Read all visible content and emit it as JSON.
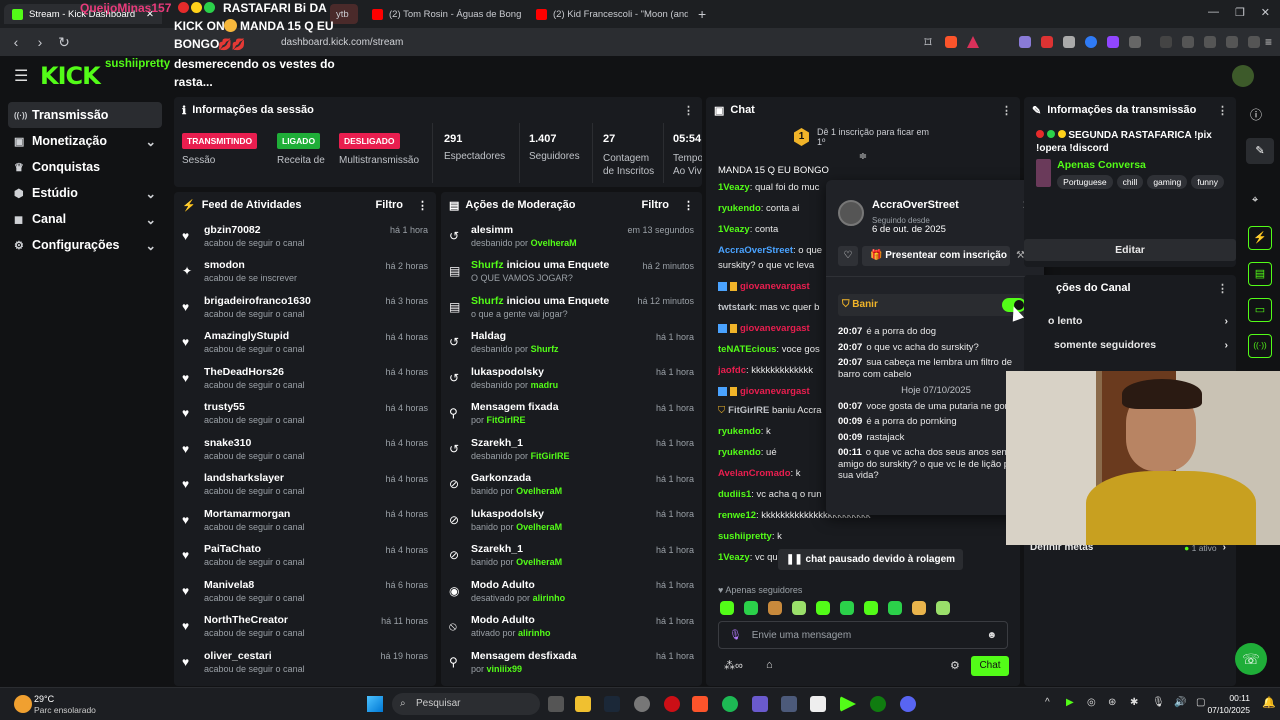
{
  "browser": {
    "tabs": [
      {
        "label": "Stream - Kick Dashboard",
        "active": true
      },
      {
        "label": "ytb"
      },
      {
        "label": "(2) Tom Rosin - Águas de Bong - You"
      },
      {
        "label": "(2) Kid Francescoli - \"Moon (and it w"
      }
    ],
    "new_tab": "+",
    "address": "dashboard.kick.com/stream"
  },
  "overlay": {
    "user": "QueijoMinas157",
    "line1": "RASTAFARI Bi DA",
    "line2": "KICK ON",
    "line2b": "MANDA 15 Q EU",
    "line3": "BONGO",
    "line4": "desmerecendo os vestes do",
    "line5": "rasta..."
  },
  "header": {
    "logo": "KICK",
    "username": "sushiipretty"
  },
  "sidebar": {
    "items": [
      {
        "label": "Transmissão",
        "icon": "broadcast-icon",
        "glyph": "((·))",
        "active": true
      },
      {
        "label": "Monetização",
        "icon": "monetization-icon",
        "glyph": "▣",
        "chevron": true
      },
      {
        "label": "Conquistas",
        "icon": "trophy-icon",
        "glyph": "🏆"
      },
      {
        "label": "Estúdio",
        "icon": "studio-icon",
        "glyph": "⬢",
        "chevron": true
      },
      {
        "label": "Canal",
        "icon": "channel-icon",
        "glyph": "◼",
        "chevron": true
      },
      {
        "label": "Configurações",
        "icon": "settings-icon",
        "glyph": "⚙",
        "chevron": true
      }
    ]
  },
  "session": {
    "title": "Informações da sessão",
    "badges": [
      {
        "text": "TRANSMITINDO",
        "color": "#e91e4f",
        "label": "Sessão"
      },
      {
        "text": "LIGADO",
        "color": "#1fae38",
        "label": "Receita de"
      },
      {
        "text": "DESLIGADO",
        "color": "#e91e4f",
        "label": "Multistransmissão"
      }
    ],
    "stats": [
      {
        "value": "291",
        "label": "Espectadores"
      },
      {
        "value": "1.407",
        "label": "Seguidores"
      },
      {
        "value": "27",
        "label": "Contagem de Inscritos"
      },
      {
        "value": "05:54:",
        "label": "Tempo Ao Vivo"
      }
    ]
  },
  "activity": {
    "title": "Feed de Atividades",
    "filter": "Filtro",
    "rows": [
      {
        "name": "gbzin70082",
        "sub": "acabou de seguir o canal",
        "time": "há 1 hora"
      },
      {
        "name": "smodon",
        "sub": "acabou de se inscrever",
        "time": "há 2 horas",
        "sub_icon": true
      },
      {
        "name": "brigadeirofranco1630",
        "sub": "acabou de seguir o canal",
        "time": "há 3 horas"
      },
      {
        "name": "AmazinglyStupid",
        "sub": "acabou de seguir o canal",
        "time": "há 4 horas"
      },
      {
        "name": "TheDeadHors26",
        "sub": "acabou de seguir o canal",
        "time": "há 4 horas"
      },
      {
        "name": "trusty55",
        "sub": "acabou de seguir o canal",
        "time": "há 4 horas"
      },
      {
        "name": "snake310",
        "sub": "acabou de seguir o canal",
        "time": "há 4 horas"
      },
      {
        "name": "landsharkslayer",
        "sub": "acabou de seguir o canal",
        "time": "há 4 horas"
      },
      {
        "name": "Mortamarmorgan",
        "sub": "acabou de seguir o canal",
        "time": "há 4 horas"
      },
      {
        "name": "PaiTaChato",
        "sub": "acabou de seguir o canal",
        "time": "há 4 horas"
      },
      {
        "name": "Manivela8",
        "sub": "acabou de seguir o canal",
        "time": "há 6 horas"
      },
      {
        "name": "NorthTheCreator",
        "sub": "acabou de seguir o canal",
        "time": "há 11 horas"
      },
      {
        "name": "oliver_cestari",
        "sub": "acabou de seguir o canal",
        "time": "há 19 horas"
      }
    ]
  },
  "moderation": {
    "title": "Ações de Moderação",
    "filter": "Filtro",
    "rows": [
      {
        "icon": "undo-icon",
        "glyph": "↺",
        "name": "alesimm",
        "sub": "desbanido por",
        "by": "OvelheraM",
        "time": "em 13 segundos"
      },
      {
        "icon": "poll-icon",
        "glyph": "▤",
        "name": "Shurfz",
        "name_green": true,
        "rest": " iniciou uma Enquete",
        "sub": "O QUE VAMOS JOGAR?",
        "time": "há 2 minutos"
      },
      {
        "icon": "poll-icon",
        "glyph": "▤",
        "name": "Shurfz",
        "name_green": true,
        "rest": " iniciou uma Enquete",
        "sub": "o que a gente vai jogar?",
        "time": "há 12 minutos"
      },
      {
        "icon": "undo-icon",
        "glyph": "↺",
        "name": "Haldag",
        "sub": "desbanido por",
        "by": "Shurfz",
        "time": "há 1 hora"
      },
      {
        "icon": "undo-icon",
        "glyph": "↺",
        "name": "lukaspodolsky",
        "sub": "desbanido por",
        "by": "madru",
        "time": "há 1 hora"
      },
      {
        "icon": "pin-icon",
        "glyph": "⚲",
        "name": "Mensagem fixada",
        "sub": "por",
        "by": "FitGirlRE",
        "time": "há 1 hora"
      },
      {
        "icon": "undo-icon",
        "glyph": "↺",
        "name": "Szarekh_1",
        "sub": "desbanido por",
        "by": "FitGirlRE",
        "time": "há 1 hora"
      },
      {
        "icon": "ban-icon",
        "glyph": "⊘",
        "name": "Garkonzada",
        "sub": "banido por",
        "by": "OvelheraM",
        "time": "há 1 hora"
      },
      {
        "icon": "ban-icon",
        "glyph": "⊘",
        "name": "lukaspodolsky",
        "sub": "banido por",
        "by": "OvelheraM",
        "time": "há 1 hora"
      },
      {
        "icon": "ban-icon",
        "glyph": "⊘",
        "name": "Szarekh_1",
        "sub": "banido por",
        "by": "OvelheraM",
        "time": "há 1 hora"
      },
      {
        "icon": "eye-icon",
        "glyph": "◉",
        "name": "Modo Adulto",
        "sub": "desativado por",
        "by": "alirinho",
        "time": "há 1 hora"
      },
      {
        "icon": "eye-off-icon",
        "glyph": "⦸",
        "name": "Modo Adulto",
        "sub": "ativado por",
        "by": "alirinho",
        "time": "há 1 hora"
      },
      {
        "icon": "unpin-icon",
        "glyph": "⚲",
        "name": "Mensagem desfixada",
        "sub": "por",
        "by": "viniiix99",
        "time": "há 1 hora"
      }
    ]
  },
  "chat": {
    "title": "Chat",
    "sub_banner": "Dê 1 inscrição para ficar em 1º",
    "pinned": "MANDA 15 Q EU BONGO",
    "messages": [
      {
        "user": "1Veazy",
        "color": "#53fc18",
        "text": ": qual foi do muc"
      },
      {
        "user": "ryukendo",
        "color": "#53fc18",
        "text": ": conta ai"
      },
      {
        "user": "1Veazy",
        "color": "#53fc18",
        "text": ": conta"
      },
      {
        "user": "AccraOverStreet",
        "color": "#4aa3ff",
        "text": ": o que"
      },
      {
        "user": "",
        "color": "#bfc2c7",
        "text": "surskity? o que vc leva"
      },
      {
        "user": "giovanevargast",
        "color": "#e91e4f",
        "text": "",
        "badges": true
      },
      {
        "user": "twtstark",
        "color": "#bfc2c7",
        "text": ": mas vc quer b"
      },
      {
        "user": "giovanevargast",
        "color": "#e91e4f",
        "text": "",
        "badges": true
      },
      {
        "user": "teNATEcious",
        "color": "#53fc18",
        "text": ": voce gos"
      },
      {
        "user": "jaofdc",
        "color": "#e91e4f",
        "text": ": kkkkkkkkkkkkk"
      },
      {
        "user": "giovanevargast",
        "color": "#e91e4f",
        "text": "",
        "badges": true
      },
      {
        "user": "FitGirlRE",
        "color": "#bfc2c7",
        "text": " baniu Accra",
        "mod": true
      },
      {
        "user": "ryukendo",
        "color": "#53fc18",
        "text": ": k"
      },
      {
        "user": "ryukendo",
        "color": "#53fc18",
        "text": ": ué"
      },
      {
        "user": "AvelanCromado",
        "color": "#e91e4f",
        "text": ": k"
      },
      {
        "user": "dudiis1",
        "color": "#53fc18",
        "text": ": vc acha q o run"
      },
      {
        "user": "renwe12",
        "color": "#53fc18",
        "text": ": kkkkkkkkkkkkkkkkkkkkkkk"
      },
      {
        "user": "sushiipretty",
        "color": "#53fc18",
        "text": ": k"
      },
      {
        "user": "1Veazy",
        "color": "#53fc18",
        "text": ": vc que"
      }
    ],
    "paused": "chat pausado devido à rolagem",
    "followers_only": "Apenas seguidores",
    "input_placeholder": "Envie uma mensagem",
    "send": "Chat"
  },
  "popup": {
    "username": "AccraOverStreet",
    "following_label": "Seguindo desde",
    "following_date": "6 de out. de 2025",
    "gift_button": "Presentear com inscrição",
    "ban_label": "Banir",
    "ban_on": true,
    "messages": [
      {
        "time": "20:07",
        "text": "é a porra do dog"
      },
      {
        "time": "20:07",
        "text": "o que vc acha do surskity?"
      },
      {
        "time": "20:07",
        "text": "sua cabeça me lembra um filtro de barro com cabelo"
      },
      {
        "divider": "Hoje 07/10/2025"
      },
      {
        "time": "00:07",
        "text": "voce gosta de uma putaria ne gordao?"
      },
      {
        "time": "00:09",
        "text": "é a porra do pornking"
      },
      {
        "time": "00:09",
        "text": "rastajack"
      },
      {
        "time": "00:11",
        "text": "o que vc acha dos seus anos sendo amigo do surskity? o que vc le de lição pra sua vida?"
      }
    ]
  },
  "stream_info": {
    "title": "Informações da transmissão",
    "stream_title": "SEGUNDA RASTAFARICA !pix !opera !discord",
    "category": "Apenas Conversa",
    "tags": [
      "Portuguese",
      "chill",
      "gaming",
      "funny"
    ],
    "edit": "Editar"
  },
  "channel_actions": {
    "title": "ções do Canal",
    "items": [
      "o lento",
      "somente seguidores"
    ],
    "goals": "Definir metas",
    "goals_status": "1 ativo"
  },
  "taskbar": {
    "weather_temp": "29°C",
    "weather_desc": "Parc ensolarado",
    "search": "Pesquisar",
    "time": "00:11",
    "date": "07/10/2025"
  }
}
